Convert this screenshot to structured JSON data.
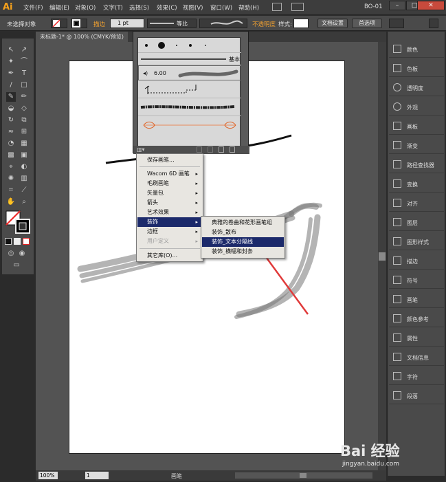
{
  "app": {
    "logo": "Ai",
    "workspace": "BO-01"
  },
  "menu": [
    "文件(F)",
    "编辑(E)",
    "对象(O)",
    "文字(T)",
    "选择(S)",
    "效果(C)",
    "视图(V)",
    "窗口(W)",
    "帮助(H)"
  ],
  "control_bar": {
    "no_selection": "未选择对象",
    "stroke_label": "描边",
    "stroke_weight": "1 pt",
    "uniform": "等比",
    "opacity_label": "不透明度",
    "style_label": "样式:",
    "doc_setup": "文档设置",
    "preferences": "首选项"
  },
  "document": {
    "tab_title": "未标题-1* @ 100% (CMYK/预览)",
    "zoom": "100%",
    "page": "1",
    "status_tool": "画笔"
  },
  "brush_panel": {
    "basic_label": "基本",
    "size_label": "6.00"
  },
  "brush_menu": {
    "items": [
      {
        "label": "保存画笔...",
        "submenu": false,
        "disabled": false
      },
      {
        "label": "Wacom 6D 画笔",
        "submenu": true,
        "disabled": false
      },
      {
        "label": "毛刷画笔",
        "submenu": true,
        "disabled": false
      },
      {
        "label": "矢量包",
        "submenu": true,
        "disabled": false
      },
      {
        "label": "箭头",
        "submenu": true,
        "disabled": false
      },
      {
        "label": "艺术效果",
        "submenu": true,
        "disabled": false
      },
      {
        "label": "装饰",
        "submenu": true,
        "disabled": false,
        "highlight": true
      },
      {
        "label": "边框",
        "submenu": true,
        "disabled": false
      },
      {
        "label": "用户定义",
        "submenu": true,
        "disabled": true
      },
      {
        "label": "其它库(O)...",
        "submenu": false,
        "disabled": false
      }
    ]
  },
  "decor_submenu": {
    "items": [
      {
        "label": "典雅的卷曲和花形画笔组"
      },
      {
        "label": "装饰_散布"
      },
      {
        "label": "装饰_文本分隔线",
        "highlight": true
      },
      {
        "label": "装饰_横幅和封条"
      }
    ]
  },
  "right_panels": [
    "颜色",
    "色板",
    "透明度",
    "外观",
    "画板",
    "渐变",
    "路径查找器",
    "变换",
    "对齐",
    "图层",
    "图形样式",
    "描边",
    "符号",
    "画笔",
    "颜色参考",
    "属性",
    "文档信息",
    "字符",
    "段落"
  ],
  "colors": {
    "accent": "#1c2a6b",
    "arrow": "#e03a3a",
    "logo": "#f7a21b"
  },
  "watermark": {
    "logo": "Bai 经验",
    "sub": "jingyan.baidu.com"
  }
}
